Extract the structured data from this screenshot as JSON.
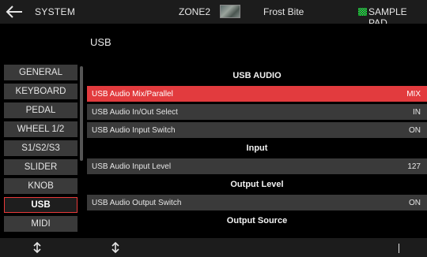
{
  "header": {
    "system_label": "SYSTEM",
    "zone_label": "ZONE2",
    "tone_name": "Frost Bite",
    "pad_label": "SAMPLE PAD",
    "icons": [
      "back-arrow-icon",
      "tone-thumbnail-icon",
      "pad-grid-icon"
    ],
    "pad_icon_color": "#3cc35c"
  },
  "page": {
    "title": "USB"
  },
  "sidebar": {
    "items": [
      {
        "label": "GENERAL",
        "active": false
      },
      {
        "label": "KEYBOARD",
        "active": false
      },
      {
        "label": "PEDAL",
        "active": false
      },
      {
        "label": "WHEEL 1/2",
        "active": false
      },
      {
        "label": "S1/S2/S3",
        "active": false
      },
      {
        "label": "SLIDER",
        "active": false
      },
      {
        "label": "KNOB",
        "active": false
      },
      {
        "label": "USB",
        "active": true
      },
      {
        "label": "MIDI",
        "active": false
      }
    ]
  },
  "content": {
    "rows": [
      {
        "type": "header",
        "label": "USB AUDIO"
      },
      {
        "type": "param",
        "label": "USB Audio Mix/Parallel",
        "value": "MIX",
        "selected": true
      },
      {
        "type": "param",
        "label": "USB Audio In/Out Select",
        "value": "IN",
        "selected": false
      },
      {
        "type": "param",
        "label": "USB Audio Input Switch",
        "value": "ON",
        "selected": false
      },
      {
        "type": "header",
        "label": "Input"
      },
      {
        "type": "param",
        "label": "USB Audio Input Level",
        "value": "127",
        "selected": false
      },
      {
        "type": "header",
        "label": "Output Level"
      },
      {
        "type": "param",
        "label": "USB Audio Output Switch",
        "value": "ON",
        "selected": false
      },
      {
        "type": "header",
        "label": "Output Source"
      }
    ]
  },
  "colors": {
    "accent": "#e23b3e",
    "row_bg": "#3a3a3a",
    "bar_bg": "#1c1c1c",
    "background": "#000000"
  }
}
